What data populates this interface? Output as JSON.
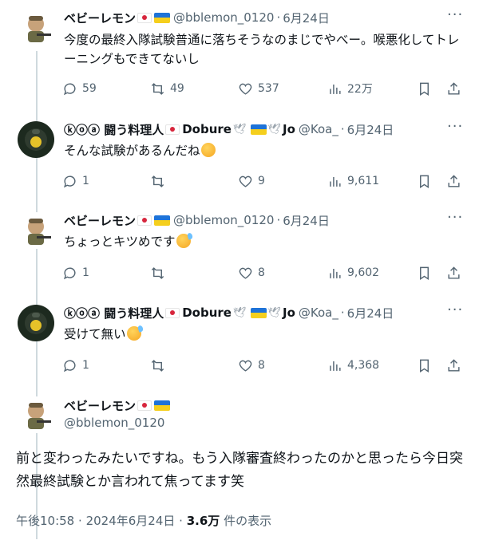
{
  "tweets": [
    {
      "name": "ベビーレモン",
      "handle": "@bblemon_0120",
      "date": "6月24日",
      "text": "今度の最終入隊試験普通に落ちそうなのまじでやべー。喉悪化してトレーニングもできてないし",
      "replies": "59",
      "retweets": "49",
      "likes": "537",
      "views": "22万"
    },
    {
      "name_prefix": "ⓚⓞⓐ 闘う料理人",
      "name_mid": "Dobure",
      "name_end": "Jo",
      "handle": "@Koa_",
      "date": "6月24日",
      "text": "そんな試験があるんだね",
      "replies": "1",
      "retweets": "",
      "likes": "9",
      "views": "9,611"
    },
    {
      "name": "ベビーレモン",
      "handle": "@bblemon_0120",
      "date": "6月24日",
      "text": "ちょっとキツめです",
      "replies": "1",
      "retweets": "",
      "likes": "8",
      "views": "9,602"
    },
    {
      "name_prefix": "ⓚⓞⓐ 闘う料理人",
      "name_mid": "Dobure",
      "name_end": "Jo",
      "handle": "@Koa_",
      "date": "6月24日",
      "text": "受けて無い",
      "replies": "1",
      "retweets": "",
      "likes": "8",
      "views": "4,368"
    }
  ],
  "main_tweet": {
    "name": "ベビーレモン",
    "handle": "@bblemon_0120",
    "text": "前と変わったみたいですね。もう入隊審査終わったのかと思ったら今日突然最終試験とか言われて焦ってます笑",
    "time": "午後10:58",
    "date": "2024年6月24日",
    "views": "3.6万",
    "views_label": "件の表示"
  },
  "separator": "·",
  "colors": {
    "text": "#0f1419",
    "secondary": "#536471",
    "thread_line": "#cfd9de"
  },
  "icons": [
    "reply-icon",
    "retweet-icon",
    "like-icon",
    "views-icon",
    "bookmark-icon",
    "share-icon",
    "more-icon"
  ]
}
